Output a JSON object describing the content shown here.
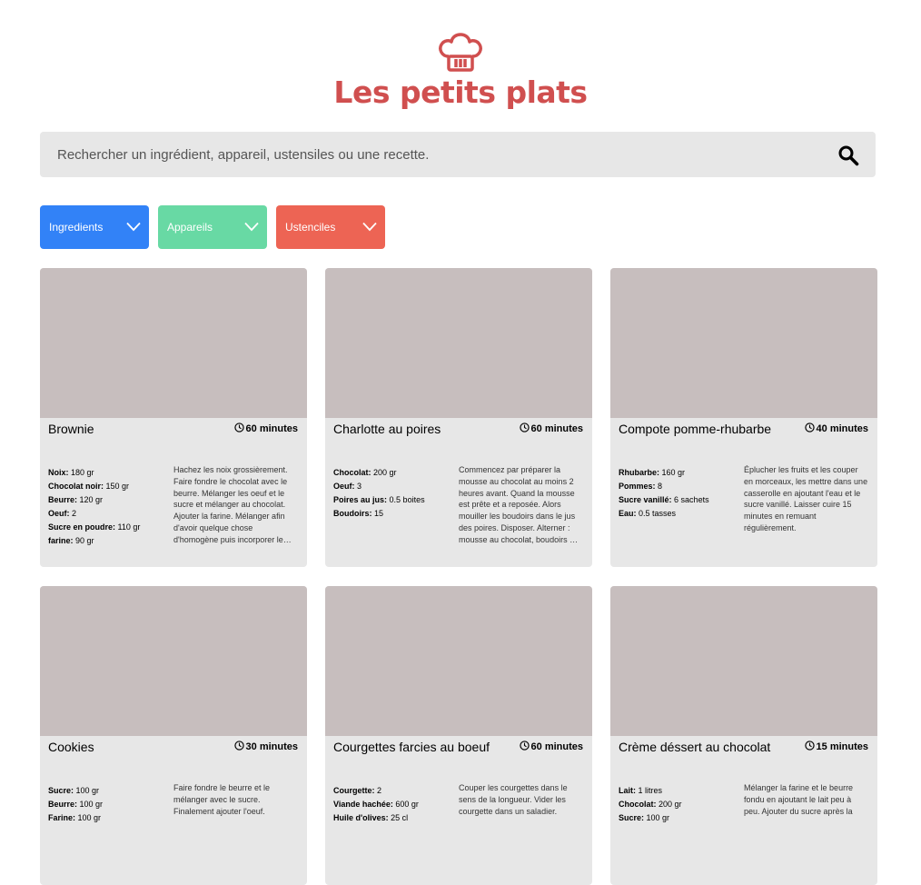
{
  "header": {
    "title": "Les petits plats"
  },
  "search": {
    "placeholder": "Rechercher un ingrédient, appareil, ustensiles ou une recette."
  },
  "filters": [
    {
      "label": "Ingredients",
      "color": "#3282F7"
    },
    {
      "label": "Appareils",
      "color": "#68D9A4"
    },
    {
      "label": "Ustenciles",
      "color": "#ED6454"
    }
  ],
  "recipes": [
    {
      "name": "Brownie",
      "time": "60 minutes",
      "ingredients": [
        {
          "name": "Noix:",
          "qty": "180 gr"
        },
        {
          "name": "Chocolat noir:",
          "qty": "150 gr"
        },
        {
          "name": "Beurre:",
          "qty": "120 gr"
        },
        {
          "name": "Oeuf:",
          "qty": "2"
        },
        {
          "name": "Sucre en poudre:",
          "qty": "110 gr"
        },
        {
          "name": "farine:",
          "qty": "90 gr"
        }
      ],
      "description": "Hachez les noix grossièrement. Faire fondre le chocolat avec le beurre. Mélanger les oeuf et le sucre et mélanger au chocolat. Ajouter la farine. Mélanger afin d'avoir quelque chose d'homogène puis incorporer le…"
    },
    {
      "name": "Charlotte au poires",
      "time": "60 minutes",
      "ingredients": [
        {
          "name": "Chocolat:",
          "qty": "200 gr"
        },
        {
          "name": "Oeuf:",
          "qty": "3"
        },
        {
          "name": "Poires au jus:",
          "qty": "0.5 boites"
        },
        {
          "name": "Boudoirs:",
          "qty": "15"
        }
      ],
      "description": "Commencez par préparer la mousse au chocolat au moins 2 heures avant. Quand la mousse est prête et a reposée. Alors mouiller les boudoirs dans le jus des poires. Disposer. Alterner : mousse au chocolat, boudoirs …"
    },
    {
      "name": "Compote pomme-rhubarbe",
      "time": "40 minutes",
      "ingredients": [
        {
          "name": "Rhubarbe:",
          "qty": "160 gr"
        },
        {
          "name": "Pommes:",
          "qty": "8"
        },
        {
          "name": "Sucre vanillé:",
          "qty": "6 sachets"
        },
        {
          "name": "Eau:",
          "qty": "0.5 tasses"
        }
      ],
      "description": "Éplucher les fruits et les couper en morceaux, les mettre dans une casserolle en ajoutant l'eau et le sucre vanillé. Laisser cuire 15 minutes en remuant régulièrement."
    },
    {
      "name": "Cookies",
      "time": "30 minutes",
      "ingredients": [
        {
          "name": "Sucre:",
          "qty": "100 gr"
        },
        {
          "name": "Beurre:",
          "qty": "100 gr"
        },
        {
          "name": "Farine:",
          "qty": "100 gr"
        }
      ],
      "description": "Faire fondre le beurre et le mélanger avec le sucre. Finalement ajouter l'oeuf."
    },
    {
      "name": "Courgettes farcies au boeuf",
      "time": "60 minutes",
      "ingredients": [
        {
          "name": "Courgette:",
          "qty": "2"
        },
        {
          "name": "Viande hachée:",
          "qty": "600 gr"
        },
        {
          "name": "Huile d'olives:",
          "qty": "25 cl"
        }
      ],
      "description": "Couper les courgettes dans le sens de la longueur. Vider les courgette dans un saladier."
    },
    {
      "name": "Crème déssert au chocolat",
      "time": "15 minutes",
      "ingredients": [
        {
          "name": "Lait:",
          "qty": "1 litres"
        },
        {
          "name": "Chocolat:",
          "qty": "200 gr"
        },
        {
          "name": "Sucre:",
          "qty": "100 gr"
        }
      ],
      "description": "Mélanger la farine et le beurre fondu en ajoutant le lait peu à peu. Ajouter du sucre après la"
    }
  ]
}
